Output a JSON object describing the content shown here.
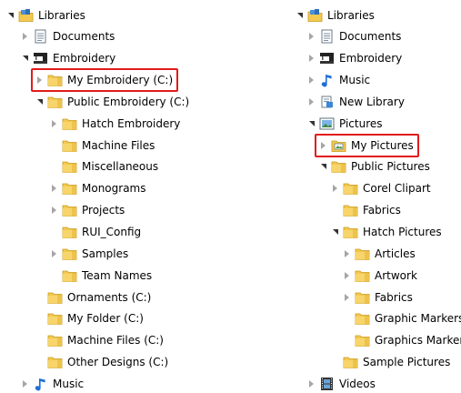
{
  "left_tree": [
    {
      "label": "Libraries",
      "icon": "libraries-icon",
      "expander": "expanded",
      "depth": 0
    },
    {
      "label": "Documents",
      "icon": "documents-library-icon",
      "expander": "collapsed",
      "depth": 1
    },
    {
      "label": "Embroidery",
      "icon": "embroidery-machine-icon",
      "expander": "expanded",
      "depth": 1
    },
    {
      "label": "My Embroidery (C:)",
      "icon": "folder-icon",
      "expander": "collapsed",
      "depth": 2,
      "highlighted": true
    },
    {
      "label": "Public Embroidery (C:)",
      "icon": "folder-icon",
      "expander": "expanded",
      "depth": 2
    },
    {
      "label": "Hatch Embroidery",
      "icon": "folder-icon",
      "expander": "collapsed",
      "depth": 3
    },
    {
      "label": "Machine Files",
      "icon": "folder-icon",
      "expander": "none",
      "depth": 3
    },
    {
      "label": "Miscellaneous",
      "icon": "folder-icon",
      "expander": "none",
      "depth": 3
    },
    {
      "label": "Monograms",
      "icon": "folder-icon",
      "expander": "collapsed",
      "depth": 3
    },
    {
      "label": "Projects",
      "icon": "folder-icon",
      "expander": "collapsed",
      "depth": 3
    },
    {
      "label": "RUI_Config",
      "icon": "folder-icon",
      "expander": "none",
      "depth": 3
    },
    {
      "label": "Samples",
      "icon": "folder-icon",
      "expander": "collapsed",
      "depth": 3
    },
    {
      "label": "Team Names",
      "icon": "folder-icon",
      "expander": "none",
      "depth": 3
    },
    {
      "label": "Ornaments (C:)",
      "icon": "folder-icon",
      "expander": "none",
      "depth": 2
    },
    {
      "label": "My Folder (C:)",
      "icon": "folder-icon",
      "expander": "none",
      "depth": 2
    },
    {
      "label": "Machine Files (C:)",
      "icon": "folder-icon",
      "expander": "none",
      "depth": 2
    },
    {
      "label": "Other Designs (C:)",
      "icon": "folder-icon",
      "expander": "none",
      "depth": 2
    },
    {
      "label": "Music",
      "icon": "music-library-icon",
      "expander": "collapsed",
      "depth": 1
    }
  ],
  "right_tree": [
    {
      "label": "Libraries",
      "icon": "libraries-icon",
      "expander": "expanded",
      "depth": 0
    },
    {
      "label": "Documents",
      "icon": "documents-library-icon",
      "expander": "collapsed",
      "depth": 1
    },
    {
      "label": "Embroidery",
      "icon": "embroidery-machine-icon",
      "expander": "collapsed",
      "depth": 1
    },
    {
      "label": "Music",
      "icon": "music-library-icon",
      "expander": "collapsed",
      "depth": 1
    },
    {
      "label": "New Library",
      "icon": "new-library-icon",
      "expander": "collapsed",
      "depth": 1
    },
    {
      "label": "Pictures",
      "icon": "pictures-library-icon",
      "expander": "expanded",
      "depth": 1
    },
    {
      "label": "My Pictures",
      "icon": "pictures-folder-icon",
      "expander": "collapsed",
      "depth": 2,
      "highlighted": true
    },
    {
      "label": "Public Pictures",
      "icon": "folder-icon",
      "expander": "expanded",
      "depth": 2
    },
    {
      "label": "Corel Clipart",
      "icon": "folder-icon",
      "expander": "collapsed",
      "depth": 3
    },
    {
      "label": "Fabrics",
      "icon": "folder-icon",
      "expander": "none",
      "depth": 3
    },
    {
      "label": "Hatch Pictures",
      "icon": "folder-icon",
      "expander": "expanded",
      "depth": 3
    },
    {
      "label": "Articles",
      "icon": "folder-icon",
      "expander": "collapsed",
      "depth": 4
    },
    {
      "label": "Artwork",
      "icon": "folder-icon",
      "expander": "collapsed",
      "depth": 4
    },
    {
      "label": "Fabrics",
      "icon": "folder-icon",
      "expander": "collapsed",
      "depth": 4
    },
    {
      "label": "Graphic Markers",
      "icon": "folder-icon",
      "expander": "none",
      "depth": 4
    },
    {
      "label": "Graphics Markers",
      "icon": "folder-icon",
      "expander": "none",
      "depth": 4
    },
    {
      "label": "Sample Pictures",
      "icon": "folder-icon",
      "expander": "none",
      "depth": 3
    },
    {
      "label": "Videos",
      "icon": "videos-library-icon",
      "expander": "collapsed",
      "depth": 1
    }
  ],
  "colors": {
    "highlight_border": "#e21b1b",
    "folder_yellow": "#f3c94f",
    "expander_gray": "#a6a6a6"
  }
}
